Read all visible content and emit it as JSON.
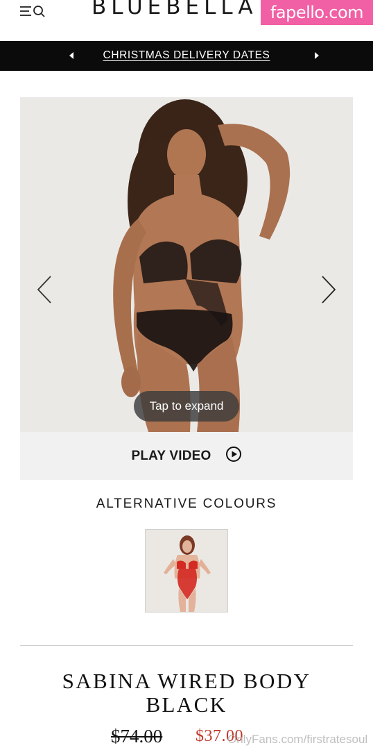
{
  "header": {
    "brand": "BLUEBELLA",
    "menu_icon": "menu-search-icon",
    "watermark": "fapello.com"
  },
  "promo": {
    "text": "CHRISTMAS DELIVERY DATES",
    "prev_icon": "caret-left-icon",
    "next_icon": "caret-right-icon"
  },
  "gallery": {
    "expand_label": "Tap to expand",
    "prev_icon": "chevron-left-icon",
    "next_icon": "chevron-right-icon"
  },
  "video": {
    "label": "PLAY VIDEO",
    "icon": "play-circle-icon"
  },
  "alternatives": {
    "title": "ALTERNATIVE COLOURS"
  },
  "product": {
    "title": "SABINA WIRED BODY BLACK",
    "price_original": "$74.00",
    "price_sale": "$37.00"
  },
  "footer_watermark": "OnlyFans.com/firstratesoul",
  "colors": {
    "promo_bg": "#0b0b0b",
    "sale_price": "#c0392b",
    "watermark_bg": "#f15fa5"
  }
}
